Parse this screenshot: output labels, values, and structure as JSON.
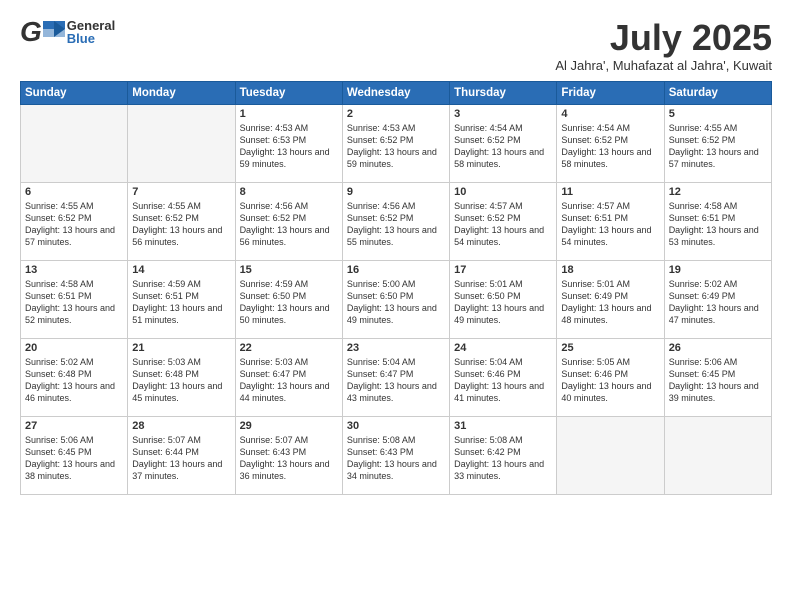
{
  "header": {
    "logo_general": "General",
    "logo_blue": "Blue",
    "month_title": "July 2025",
    "subtitle": "Al Jahra', Muhafazat al Jahra', Kuwait"
  },
  "days_of_week": [
    "Sunday",
    "Monday",
    "Tuesday",
    "Wednesday",
    "Thursday",
    "Friday",
    "Saturday"
  ],
  "weeks": [
    [
      {
        "day": "",
        "empty": true
      },
      {
        "day": "",
        "empty": true
      },
      {
        "day": "1",
        "sunrise": "Sunrise: 4:53 AM",
        "sunset": "Sunset: 6:53 PM",
        "daylight": "Daylight: 13 hours and 59 minutes."
      },
      {
        "day": "2",
        "sunrise": "Sunrise: 4:53 AM",
        "sunset": "Sunset: 6:52 PM",
        "daylight": "Daylight: 13 hours and 59 minutes."
      },
      {
        "day": "3",
        "sunrise": "Sunrise: 4:54 AM",
        "sunset": "Sunset: 6:52 PM",
        "daylight": "Daylight: 13 hours and 58 minutes."
      },
      {
        "day": "4",
        "sunrise": "Sunrise: 4:54 AM",
        "sunset": "Sunset: 6:52 PM",
        "daylight": "Daylight: 13 hours and 58 minutes."
      },
      {
        "day": "5",
        "sunrise": "Sunrise: 4:55 AM",
        "sunset": "Sunset: 6:52 PM",
        "daylight": "Daylight: 13 hours and 57 minutes."
      }
    ],
    [
      {
        "day": "6",
        "sunrise": "Sunrise: 4:55 AM",
        "sunset": "Sunset: 6:52 PM",
        "daylight": "Daylight: 13 hours and 57 minutes."
      },
      {
        "day": "7",
        "sunrise": "Sunrise: 4:55 AM",
        "sunset": "Sunset: 6:52 PM",
        "daylight": "Daylight: 13 hours and 56 minutes."
      },
      {
        "day": "8",
        "sunrise": "Sunrise: 4:56 AM",
        "sunset": "Sunset: 6:52 PM",
        "daylight": "Daylight: 13 hours and 56 minutes."
      },
      {
        "day": "9",
        "sunrise": "Sunrise: 4:56 AM",
        "sunset": "Sunset: 6:52 PM",
        "daylight": "Daylight: 13 hours and 55 minutes."
      },
      {
        "day": "10",
        "sunrise": "Sunrise: 4:57 AM",
        "sunset": "Sunset: 6:52 PM",
        "daylight": "Daylight: 13 hours and 54 minutes."
      },
      {
        "day": "11",
        "sunrise": "Sunrise: 4:57 AM",
        "sunset": "Sunset: 6:51 PM",
        "daylight": "Daylight: 13 hours and 54 minutes."
      },
      {
        "day": "12",
        "sunrise": "Sunrise: 4:58 AM",
        "sunset": "Sunset: 6:51 PM",
        "daylight": "Daylight: 13 hours and 53 minutes."
      }
    ],
    [
      {
        "day": "13",
        "sunrise": "Sunrise: 4:58 AM",
        "sunset": "Sunset: 6:51 PM",
        "daylight": "Daylight: 13 hours and 52 minutes."
      },
      {
        "day": "14",
        "sunrise": "Sunrise: 4:59 AM",
        "sunset": "Sunset: 6:51 PM",
        "daylight": "Daylight: 13 hours and 51 minutes."
      },
      {
        "day": "15",
        "sunrise": "Sunrise: 4:59 AM",
        "sunset": "Sunset: 6:50 PM",
        "daylight": "Daylight: 13 hours and 50 minutes."
      },
      {
        "day": "16",
        "sunrise": "Sunrise: 5:00 AM",
        "sunset": "Sunset: 6:50 PM",
        "daylight": "Daylight: 13 hours and 49 minutes."
      },
      {
        "day": "17",
        "sunrise": "Sunrise: 5:01 AM",
        "sunset": "Sunset: 6:50 PM",
        "daylight": "Daylight: 13 hours and 49 minutes."
      },
      {
        "day": "18",
        "sunrise": "Sunrise: 5:01 AM",
        "sunset": "Sunset: 6:49 PM",
        "daylight": "Daylight: 13 hours and 48 minutes."
      },
      {
        "day": "19",
        "sunrise": "Sunrise: 5:02 AM",
        "sunset": "Sunset: 6:49 PM",
        "daylight": "Daylight: 13 hours and 47 minutes."
      }
    ],
    [
      {
        "day": "20",
        "sunrise": "Sunrise: 5:02 AM",
        "sunset": "Sunset: 6:48 PM",
        "daylight": "Daylight: 13 hours and 46 minutes."
      },
      {
        "day": "21",
        "sunrise": "Sunrise: 5:03 AM",
        "sunset": "Sunset: 6:48 PM",
        "daylight": "Daylight: 13 hours and 45 minutes."
      },
      {
        "day": "22",
        "sunrise": "Sunrise: 5:03 AM",
        "sunset": "Sunset: 6:47 PM",
        "daylight": "Daylight: 13 hours and 44 minutes."
      },
      {
        "day": "23",
        "sunrise": "Sunrise: 5:04 AM",
        "sunset": "Sunset: 6:47 PM",
        "daylight": "Daylight: 13 hours and 43 minutes."
      },
      {
        "day": "24",
        "sunrise": "Sunrise: 5:04 AM",
        "sunset": "Sunset: 6:46 PM",
        "daylight": "Daylight: 13 hours and 41 minutes."
      },
      {
        "day": "25",
        "sunrise": "Sunrise: 5:05 AM",
        "sunset": "Sunset: 6:46 PM",
        "daylight": "Daylight: 13 hours and 40 minutes."
      },
      {
        "day": "26",
        "sunrise": "Sunrise: 5:06 AM",
        "sunset": "Sunset: 6:45 PM",
        "daylight": "Daylight: 13 hours and 39 minutes."
      }
    ],
    [
      {
        "day": "27",
        "sunrise": "Sunrise: 5:06 AM",
        "sunset": "Sunset: 6:45 PM",
        "daylight": "Daylight: 13 hours and 38 minutes."
      },
      {
        "day": "28",
        "sunrise": "Sunrise: 5:07 AM",
        "sunset": "Sunset: 6:44 PM",
        "daylight": "Daylight: 13 hours and 37 minutes."
      },
      {
        "day": "29",
        "sunrise": "Sunrise: 5:07 AM",
        "sunset": "Sunset: 6:43 PM",
        "daylight": "Daylight: 13 hours and 36 minutes."
      },
      {
        "day": "30",
        "sunrise": "Sunrise: 5:08 AM",
        "sunset": "Sunset: 6:43 PM",
        "daylight": "Daylight: 13 hours and 34 minutes."
      },
      {
        "day": "31",
        "sunrise": "Sunrise: 5:08 AM",
        "sunset": "Sunset: 6:42 PM",
        "daylight": "Daylight: 13 hours and 33 minutes."
      },
      {
        "day": "",
        "empty": true
      },
      {
        "day": "",
        "empty": true
      }
    ]
  ]
}
